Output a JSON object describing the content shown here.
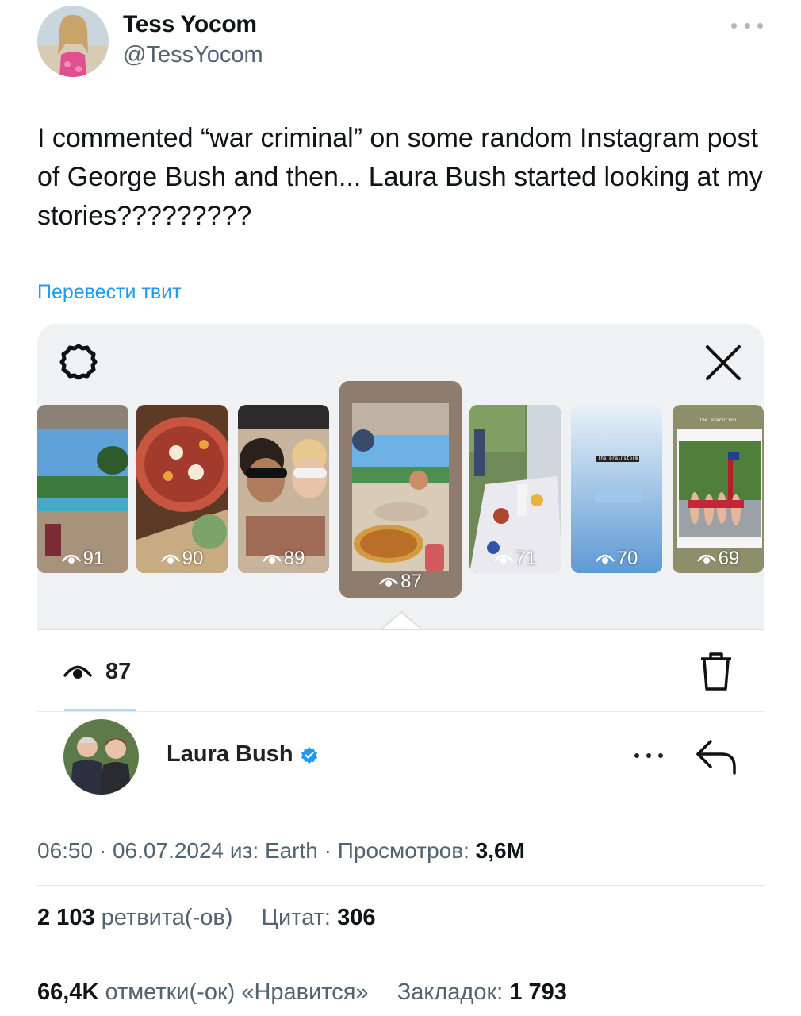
{
  "author": {
    "name": "Tess Yocom",
    "handle": "@TessYocom"
  },
  "tweet": {
    "text": "I commented “war criminal” on some random Instagram post of George Bush and then... Laura Bush started looking at my stories?????????",
    "translate_label": "Перевести твит"
  },
  "screenshot": {
    "stories": [
      {
        "views": "91"
      },
      {
        "views": "90"
      },
      {
        "views": "89"
      },
      {
        "views": "87"
      },
      {
        "views": "71"
      },
      {
        "views": "70"
      },
      {
        "views": "69"
      }
    ],
    "story_texts": {
      "brainstorm": "The brainstorm",
      "execution": "The execution"
    },
    "current_views": "87",
    "viewer": {
      "name": "Laura Bush"
    }
  },
  "meta": {
    "time": "06:50",
    "date": "06.07.2024",
    "source_prefix": "из:",
    "source": "Earth",
    "views_label": "Просмотров:",
    "views_value": "3,6M"
  },
  "stats": {
    "retweets_value": "2 103",
    "retweets_label": "ретвита(-ов)",
    "quotes_label": "Цитат:",
    "quotes_value": "306",
    "likes_value": "66,4K",
    "likes_label": "отметки(-ок) «Нравится»",
    "bookmarks_label": "Закладок:",
    "bookmarks_value": "1 793"
  },
  "colors": {
    "link_blue": "#1d9bf0",
    "secondary_text": "#536471",
    "card_bg": "#eff1f3"
  },
  "icons": [
    "gear-icon",
    "close-icon",
    "eye-icon",
    "trash-icon",
    "verified-badge-icon",
    "more-icon",
    "reply-icon"
  ]
}
